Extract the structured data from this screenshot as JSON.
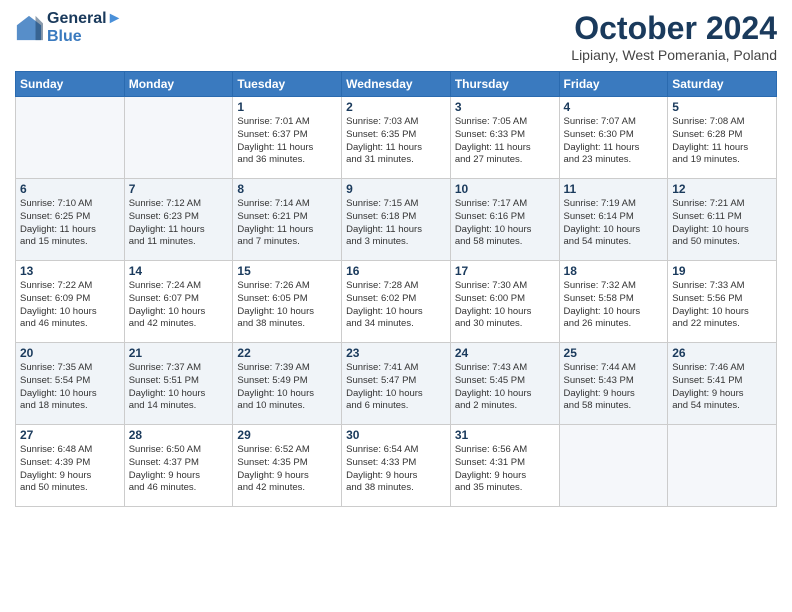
{
  "logo": {
    "line1": "General",
    "line2": "Blue"
  },
  "title": "October 2024",
  "location": "Lipiany, West Pomerania, Poland",
  "weekdays": [
    "Sunday",
    "Monday",
    "Tuesday",
    "Wednesday",
    "Thursday",
    "Friday",
    "Saturday"
  ],
  "weeks": [
    [
      {
        "day": "",
        "info": ""
      },
      {
        "day": "",
        "info": ""
      },
      {
        "day": "1",
        "info": "Sunrise: 7:01 AM\nSunset: 6:37 PM\nDaylight: 11 hours\nand 36 minutes."
      },
      {
        "day": "2",
        "info": "Sunrise: 7:03 AM\nSunset: 6:35 PM\nDaylight: 11 hours\nand 31 minutes."
      },
      {
        "day": "3",
        "info": "Sunrise: 7:05 AM\nSunset: 6:33 PM\nDaylight: 11 hours\nand 27 minutes."
      },
      {
        "day": "4",
        "info": "Sunrise: 7:07 AM\nSunset: 6:30 PM\nDaylight: 11 hours\nand 23 minutes."
      },
      {
        "day": "5",
        "info": "Sunrise: 7:08 AM\nSunset: 6:28 PM\nDaylight: 11 hours\nand 19 minutes."
      }
    ],
    [
      {
        "day": "6",
        "info": "Sunrise: 7:10 AM\nSunset: 6:25 PM\nDaylight: 11 hours\nand 15 minutes."
      },
      {
        "day": "7",
        "info": "Sunrise: 7:12 AM\nSunset: 6:23 PM\nDaylight: 11 hours\nand 11 minutes."
      },
      {
        "day": "8",
        "info": "Sunrise: 7:14 AM\nSunset: 6:21 PM\nDaylight: 11 hours\nand 7 minutes."
      },
      {
        "day": "9",
        "info": "Sunrise: 7:15 AM\nSunset: 6:18 PM\nDaylight: 11 hours\nand 3 minutes."
      },
      {
        "day": "10",
        "info": "Sunrise: 7:17 AM\nSunset: 6:16 PM\nDaylight: 10 hours\nand 58 minutes."
      },
      {
        "day": "11",
        "info": "Sunrise: 7:19 AM\nSunset: 6:14 PM\nDaylight: 10 hours\nand 54 minutes."
      },
      {
        "day": "12",
        "info": "Sunrise: 7:21 AM\nSunset: 6:11 PM\nDaylight: 10 hours\nand 50 minutes."
      }
    ],
    [
      {
        "day": "13",
        "info": "Sunrise: 7:22 AM\nSunset: 6:09 PM\nDaylight: 10 hours\nand 46 minutes."
      },
      {
        "day": "14",
        "info": "Sunrise: 7:24 AM\nSunset: 6:07 PM\nDaylight: 10 hours\nand 42 minutes."
      },
      {
        "day": "15",
        "info": "Sunrise: 7:26 AM\nSunset: 6:05 PM\nDaylight: 10 hours\nand 38 minutes."
      },
      {
        "day": "16",
        "info": "Sunrise: 7:28 AM\nSunset: 6:02 PM\nDaylight: 10 hours\nand 34 minutes."
      },
      {
        "day": "17",
        "info": "Sunrise: 7:30 AM\nSunset: 6:00 PM\nDaylight: 10 hours\nand 30 minutes."
      },
      {
        "day": "18",
        "info": "Sunrise: 7:32 AM\nSunset: 5:58 PM\nDaylight: 10 hours\nand 26 minutes."
      },
      {
        "day": "19",
        "info": "Sunrise: 7:33 AM\nSunset: 5:56 PM\nDaylight: 10 hours\nand 22 minutes."
      }
    ],
    [
      {
        "day": "20",
        "info": "Sunrise: 7:35 AM\nSunset: 5:54 PM\nDaylight: 10 hours\nand 18 minutes."
      },
      {
        "day": "21",
        "info": "Sunrise: 7:37 AM\nSunset: 5:51 PM\nDaylight: 10 hours\nand 14 minutes."
      },
      {
        "day": "22",
        "info": "Sunrise: 7:39 AM\nSunset: 5:49 PM\nDaylight: 10 hours\nand 10 minutes."
      },
      {
        "day": "23",
        "info": "Sunrise: 7:41 AM\nSunset: 5:47 PM\nDaylight: 10 hours\nand 6 minutes."
      },
      {
        "day": "24",
        "info": "Sunrise: 7:43 AM\nSunset: 5:45 PM\nDaylight: 10 hours\nand 2 minutes."
      },
      {
        "day": "25",
        "info": "Sunrise: 7:44 AM\nSunset: 5:43 PM\nDaylight: 9 hours\nand 58 minutes."
      },
      {
        "day": "26",
        "info": "Sunrise: 7:46 AM\nSunset: 5:41 PM\nDaylight: 9 hours\nand 54 minutes."
      }
    ],
    [
      {
        "day": "27",
        "info": "Sunrise: 6:48 AM\nSunset: 4:39 PM\nDaylight: 9 hours\nand 50 minutes."
      },
      {
        "day": "28",
        "info": "Sunrise: 6:50 AM\nSunset: 4:37 PM\nDaylight: 9 hours\nand 46 minutes."
      },
      {
        "day": "29",
        "info": "Sunrise: 6:52 AM\nSunset: 4:35 PM\nDaylight: 9 hours\nand 42 minutes."
      },
      {
        "day": "30",
        "info": "Sunrise: 6:54 AM\nSunset: 4:33 PM\nDaylight: 9 hours\nand 38 minutes."
      },
      {
        "day": "31",
        "info": "Sunrise: 6:56 AM\nSunset: 4:31 PM\nDaylight: 9 hours\nand 35 minutes."
      },
      {
        "day": "",
        "info": ""
      },
      {
        "day": "",
        "info": ""
      }
    ]
  ]
}
